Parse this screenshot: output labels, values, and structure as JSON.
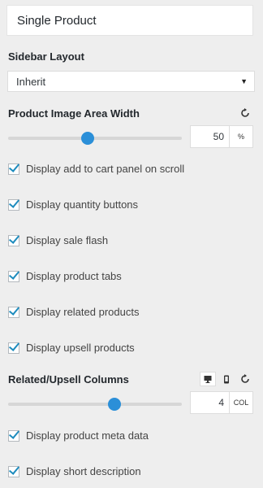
{
  "header": {
    "title": "Single Product"
  },
  "sidebar_layout": {
    "label": "Sidebar Layout",
    "selected": "Inherit"
  },
  "image_width": {
    "label": "Product Image Area Width",
    "value": "50",
    "unit": "%",
    "slider_fraction": 0.46
  },
  "checks_top": [
    {
      "label": "Display add to cart panel on scroll",
      "checked": true
    },
    {
      "label": "Display quantity buttons",
      "checked": true
    },
    {
      "label": "Display sale flash",
      "checked": true
    },
    {
      "label": "Display product tabs",
      "checked": true
    },
    {
      "label": "Display related products",
      "checked": true
    },
    {
      "label": "Display upsell products",
      "checked": true
    }
  ],
  "columns": {
    "label": "Related/Upsell Columns",
    "value": "4",
    "unit": "COL",
    "slider_fraction": 0.61,
    "devices": [
      "desktop-icon",
      "mobile-icon"
    ]
  },
  "checks_bottom": [
    {
      "label": "Display product meta data",
      "checked": true
    },
    {
      "label": "Display short description",
      "checked": true
    }
  ]
}
